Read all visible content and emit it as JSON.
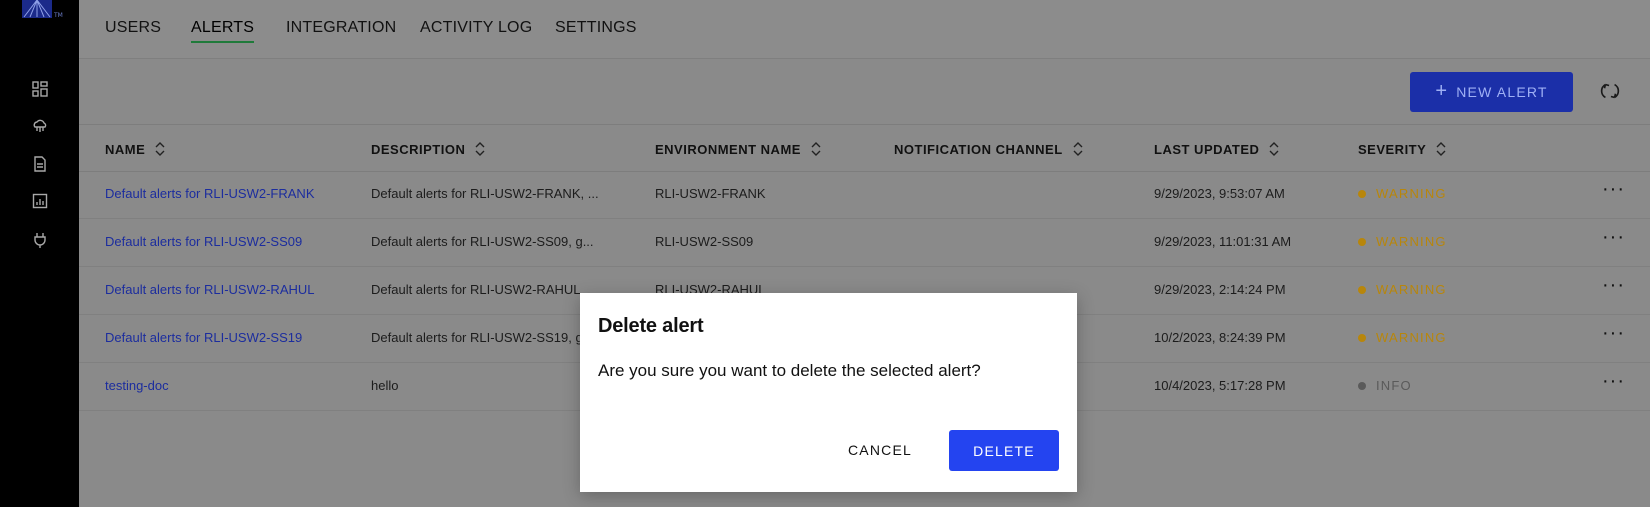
{
  "tabs": [
    {
      "label": "USERS",
      "active": false
    },
    {
      "label": "ALERTS",
      "active": true
    },
    {
      "label": "INTEGRATION",
      "active": false
    },
    {
      "label": "ACTIVITY LOG",
      "active": false
    },
    {
      "label": "SETTINGS",
      "active": false
    }
  ],
  "toolbar": {
    "new_alert_label": "NEW ALERT",
    "new_alert_icon": "plus-icon",
    "refresh_icon": "refresh-icon"
  },
  "sidebar": {
    "logo_tm": "TM",
    "icons": [
      "dashboard-icon",
      "cloud-network-icon",
      "document-icon",
      "report-chart-icon",
      "plug-icon"
    ]
  },
  "table": {
    "headers": [
      "NAME",
      "DESCRIPTION",
      "ENVIRONMENT NAME",
      "NOTIFICATION CHANNEL",
      "LAST UPDATED",
      "SEVERITY"
    ],
    "rows": [
      {
        "name": "Default alerts for RLI-USW2-FRANK",
        "description": "Default alerts for RLI-USW2-FRANK, ...",
        "environment": "RLI-USW2-FRANK",
        "channel": "",
        "updated": "9/29/2023, 9:53:07 AM",
        "severity": "WARNING"
      },
      {
        "name": "Default alerts for RLI-USW2-SS09",
        "description": "Default alerts for RLI-USW2-SS09, g...",
        "environment": "RLI-USW2-SS09",
        "channel": "",
        "updated": "9/29/2023, 11:01:31 AM",
        "severity": "WARNING"
      },
      {
        "name": "Default alerts for RLI-USW2-RAHUL",
        "description": "Default alerts for RLI-USW2-RAHUL",
        "environment": "RLI-USW2-RAHUL",
        "channel": "",
        "updated": "9/29/2023, 2:14:24 PM",
        "severity": "WARNING"
      },
      {
        "name": "Default alerts for RLI-USW2-SS19",
        "description": "Default alerts for RLI-USW2-SS19, g",
        "environment": "",
        "channel": "",
        "updated": "10/2/2023, 8:24:39 PM",
        "severity": "WARNING"
      },
      {
        "name": "testing-doc",
        "description": "hello",
        "environment": "",
        "channel": "",
        "updated": "10/4/2023, 5:17:28 PM",
        "severity": "INFO"
      }
    ]
  },
  "colors": {
    "warning": "#b8860b",
    "info": "#5a5a5a",
    "link": "#1c2d9e",
    "primary": "#2444f0"
  },
  "modal": {
    "title": "Delete alert",
    "body": "Are you sure you want to delete the selected alert?",
    "cancel_label": "CANCEL",
    "delete_label": "DELETE"
  }
}
